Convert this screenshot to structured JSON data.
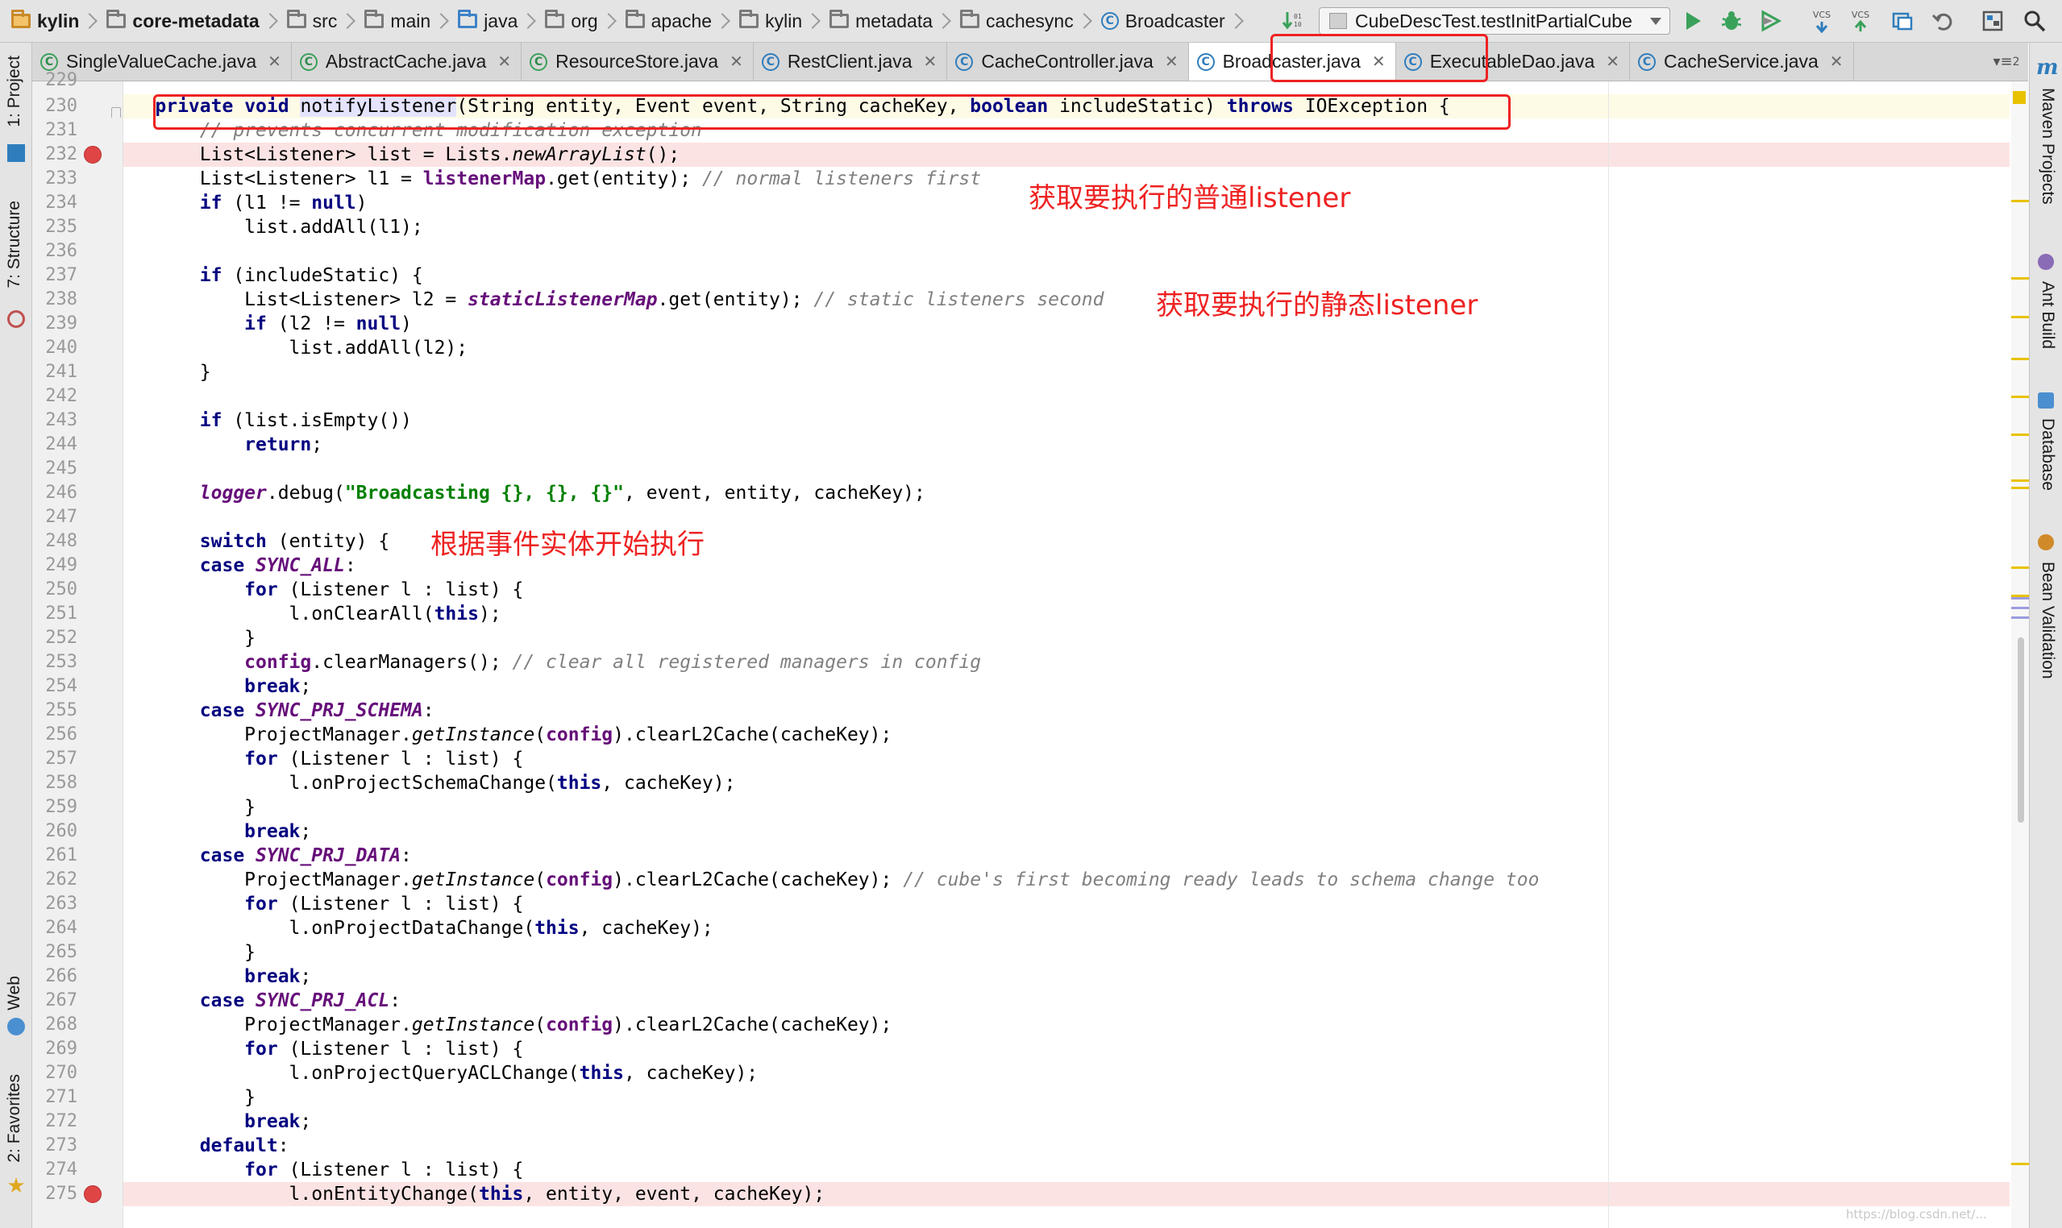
{
  "breadcrumbs": [
    "kylin",
    "core-metadata",
    "src",
    "main",
    "java",
    "org",
    "apache",
    "kylin",
    "metadata",
    "cachesync",
    "Broadcaster"
  ],
  "run_config": "CubeDescTest.testInitPartialCube",
  "toolbar": {
    "vcs_update": "VCS",
    "vcs_commit": "VCS"
  },
  "tabs": [
    {
      "label": "SingleValueCache.java",
      "icon": "class-green"
    },
    {
      "label": "AbstractCache.java",
      "icon": "class-green"
    },
    {
      "label": "ResourceStore.java",
      "icon": "class-green"
    },
    {
      "label": "RestClient.java",
      "icon": "class"
    },
    {
      "label": "CacheController.java",
      "icon": "class"
    },
    {
      "label": "Broadcaster.java",
      "icon": "class",
      "active": true
    },
    {
      "label": "ExecutableDao.java",
      "icon": "class"
    },
    {
      "label": "CacheService.java",
      "icon": "class"
    }
  ],
  "tab_overflow": "2",
  "left_tools": [
    "1: Project",
    "7: Structure",
    "Web",
    "2: Favorites"
  ],
  "right_tools": [
    "Maven Projects",
    "Ant Build",
    "Database",
    "Bean Validation"
  ],
  "editor": {
    "first_line_partial": "229",
    "lines": [
      {
        "n": 230,
        "text": "    private void notifyListener(String entity, Event event, String cacheKey, boolean includeStatic) throws IOException {"
      },
      {
        "n": 231,
        "text": "        // prevents concurrent modification exception"
      },
      {
        "n": 232,
        "text": "        List<Listener> list = Lists.newArrayList();"
      },
      {
        "n": 233,
        "text": "        List<Listener> l1 = listenerMap.get(entity); // normal listeners first"
      },
      {
        "n": 234,
        "text": "        if (l1 != null)"
      },
      {
        "n": 235,
        "text": "            list.addAll(l1);"
      },
      {
        "n": 236,
        "text": ""
      },
      {
        "n": 237,
        "text": "        if (includeStatic) {"
      },
      {
        "n": 238,
        "text": "            List<Listener> l2 = staticListenerMap.get(entity); // static listeners second"
      },
      {
        "n": 239,
        "text": "            if (l2 != null)"
      },
      {
        "n": 240,
        "text": "                list.addAll(l2);"
      },
      {
        "n": 241,
        "text": "        }"
      },
      {
        "n": 242,
        "text": ""
      },
      {
        "n": 243,
        "text": "        if (list.isEmpty())"
      },
      {
        "n": 244,
        "text": "            return;"
      },
      {
        "n": 245,
        "text": ""
      },
      {
        "n": 246,
        "text": "        logger.debug(\"Broadcasting {}, {}, {}\", event, entity, cacheKey);"
      },
      {
        "n": 247,
        "text": ""
      },
      {
        "n": 248,
        "text": "        switch (entity) {"
      },
      {
        "n": 249,
        "text": "        case SYNC_ALL:"
      },
      {
        "n": 250,
        "text": "            for (Listener l : list) {"
      },
      {
        "n": 251,
        "text": "                l.onClearAll(this);"
      },
      {
        "n": 252,
        "text": "            }"
      },
      {
        "n": 253,
        "text": "            config.clearManagers(); // clear all registered managers in config"
      },
      {
        "n": 254,
        "text": "            break;"
      },
      {
        "n": 255,
        "text": "        case SYNC_PRJ_SCHEMA:"
      },
      {
        "n": 256,
        "text": "            ProjectManager.getInstance(config).clearL2Cache(cacheKey);"
      },
      {
        "n": 257,
        "text": "            for (Listener l : list) {"
      },
      {
        "n": 258,
        "text": "                l.onProjectSchemaChange(this, cacheKey);"
      },
      {
        "n": 259,
        "text": "            }"
      },
      {
        "n": 260,
        "text": "            break;"
      },
      {
        "n": 261,
        "text": "        case SYNC_PRJ_DATA:"
      },
      {
        "n": 262,
        "text": "            ProjectManager.getInstance(config).clearL2Cache(cacheKey); // cube's first becoming ready leads to schema change too"
      },
      {
        "n": 263,
        "text": "            for (Listener l : list) {"
      },
      {
        "n": 264,
        "text": "                l.onProjectDataChange(this, cacheKey);"
      },
      {
        "n": 265,
        "text": "            }"
      },
      {
        "n": 266,
        "text": "            break;"
      },
      {
        "n": 267,
        "text": "        case SYNC_PRJ_ACL:"
      },
      {
        "n": 268,
        "text": "            ProjectManager.getInstance(config).clearL2Cache(cacheKey);"
      },
      {
        "n": 269,
        "text": "            for (Listener l : list) {"
      },
      {
        "n": 270,
        "text": "                l.onProjectQueryACLChange(this, cacheKey);"
      },
      {
        "n": 271,
        "text": "            }"
      },
      {
        "n": 272,
        "text": "            break;"
      },
      {
        "n": 273,
        "text": "        default:"
      },
      {
        "n": 274,
        "text": "            for (Listener l : list) {"
      },
      {
        "n": 275,
        "text": "                l.onEntityChange(this, entity, event, cacheKey);"
      }
    ],
    "breakpoint_lines": [
      232,
      275
    ],
    "current_line": 230
  },
  "annotations": {
    "normal_listener": "获取要执行的普通listener",
    "static_listener": "获取要执行的静态listener",
    "switch_entity": "根据事件实体开始执行"
  },
  "watermark": "https://blog.csdn.net/...",
  "colors": {
    "keyword": "#000080",
    "comment": "#808080",
    "field": "#660e7a",
    "string": "#008000",
    "annotation": "#ee2222",
    "breakpoint": "#e04545"
  }
}
